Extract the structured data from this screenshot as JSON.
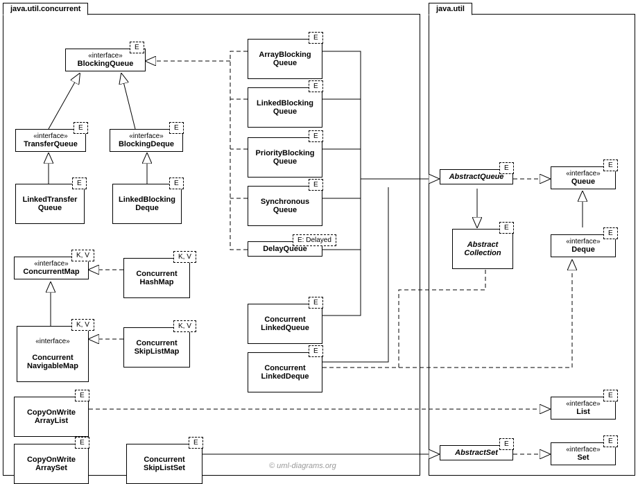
{
  "packages": {
    "concurrent": "java.util.concurrent",
    "util": "java.util"
  },
  "stereo": {
    "interface": "«interface»"
  },
  "tp": {
    "E": "E",
    "KV": "K, V",
    "EDelayed": "E: Delayed"
  },
  "c": {
    "BlockingQueue": "BlockingQueue",
    "TransferQueue": "TransferQueue",
    "BlockingDeque": "BlockingDeque",
    "LinkedTransferQueue": "LinkedTransfer\nQueue",
    "LinkedBlockingDeque": "LinkedBlocking\nDeque",
    "ConcurrentMap": "ConcurrentMap",
    "ConcurrentHashMap": "Concurrent\nHashMap",
    "ConcurrentNavigableMap": "Concurrent\nNavigableMap",
    "ConcurrentSkipListMap": "Concurrent\nSkipListMap",
    "CopyOnWriteArrayList": "CopyOnWrite\nArrayList",
    "CopyOnWriteArraySet": "CopyOnWrite\nArraySet",
    "ConcurrentSkipListSet": "Concurrent\nSkipListSet",
    "ArrayBlockingQueue": "ArrayBlocking\nQueue",
    "LinkedBlockingQueue": "LinkedBlocking\nQueue",
    "PriorityBlockingQueue": "PriorityBlocking\nQueue",
    "SynchronousQueue": "Synchronous\nQueue",
    "DelayQueue": "DelayQueue",
    "ConcurrentLinkedQueue": "Concurrent\nLinkedQueue",
    "ConcurrentLinkedDeque": "Concurrent\nLinkedDeque",
    "AbstractQueue": "AbstractQueue",
    "AbstractCollection": "Abstract\nCollection",
    "AbstractSet": "AbstractSet",
    "Queue": "Queue",
    "Deque": "Deque",
    "List": "List",
    "Set": "Set"
  },
  "watermark": "© uml-diagrams.org"
}
